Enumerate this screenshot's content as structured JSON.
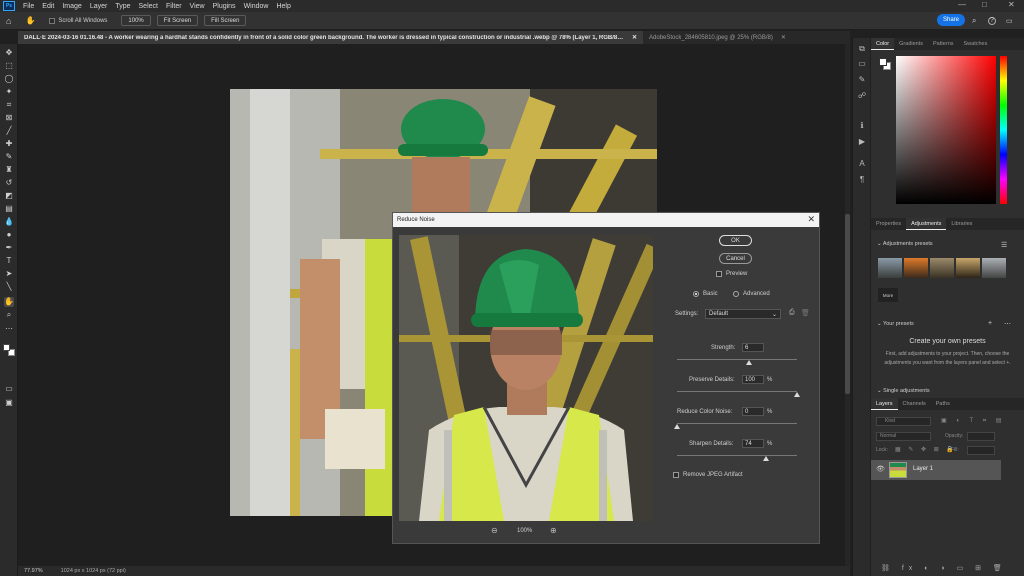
{
  "app": {
    "logo": "Ps"
  },
  "menu": [
    "File",
    "Edit",
    "Image",
    "Layer",
    "Type",
    "Select",
    "Filter",
    "View",
    "Plugins",
    "Window",
    "Help"
  ],
  "window_controls": {
    "minimize": "—",
    "maximize": "□",
    "close": "✕"
  },
  "options_bar": {
    "scroll_all_windows": "Scroll All Windows",
    "zoom_100": "100%",
    "fit_screen": "Fit Screen",
    "fill_screen": "Fill Screen",
    "share": "Share"
  },
  "tabs": [
    {
      "label": "DALL·E 2024-03-16 01.16.48 - A worker wearing a hardhat stands confidently in front of a solid color green background. The worker is dressed in typical construction or industrial .webp @ 78% (Layer 1, RGB/8#) *",
      "active": true
    },
    {
      "label": "AdobeStock_284605810.jpeg @ 25% (RGB/8)",
      "active": false
    }
  ],
  "status_bar": {
    "zoom": "77.97%",
    "doc_size": "1024 px x 1024 px (72 ppi)"
  },
  "dialog": {
    "title": "Reduce Noise",
    "ok": "OK",
    "cancel": "Cancel",
    "preview": "Preview",
    "mode_basic": "Basic",
    "mode_advanced": "Advanced",
    "settings_label": "Settings:",
    "settings_value": "Default",
    "strength": {
      "label": "Strength:",
      "value": "6",
      "level": 0.6
    },
    "preserve_details": {
      "label": "Preserve Details:",
      "value": "100",
      "unit": "%",
      "level": 1.0
    },
    "reduce_color_noise": {
      "label": "Reduce Color Noise:",
      "value": "0",
      "unit": "%",
      "level": 0.0
    },
    "sharpen_details": {
      "label": "Sharpen Details:",
      "value": "74",
      "unit": "%",
      "level": 0.74
    },
    "remove_jpeg": "Remove JPEG Artifact",
    "zoom": "100%"
  },
  "color_panel": {
    "tabs": [
      "Color",
      "Gradients",
      "Patterns",
      "Swatches"
    ]
  },
  "adjustments_panel": {
    "tabs": [
      "Properties",
      "Adjustments",
      "Libraries"
    ],
    "presets_title": "Adjustments presets",
    "more": "More",
    "your_presets": "Your presets",
    "create_title": "Create your own presets",
    "create_text": "First, add adjustments to your project. Then, choose the adjustments you want from the layers panel and select +.",
    "single_adjustments": "Single adjustments"
  },
  "layers_panel": {
    "tabs": [
      "Layers",
      "Channels",
      "Paths"
    ],
    "search": "Kind",
    "blend": "Normal",
    "opacity_label": "Opacity:",
    "lock_label": "Lock:",
    "fill_label": "Fill:",
    "layer_name": "Layer 1"
  },
  "colors": {
    "accent": "#1473e6",
    "dialog_bg": "#3a3a3a",
    "hardhat": "#1f8a4c",
    "vest": "#d6e84a"
  }
}
